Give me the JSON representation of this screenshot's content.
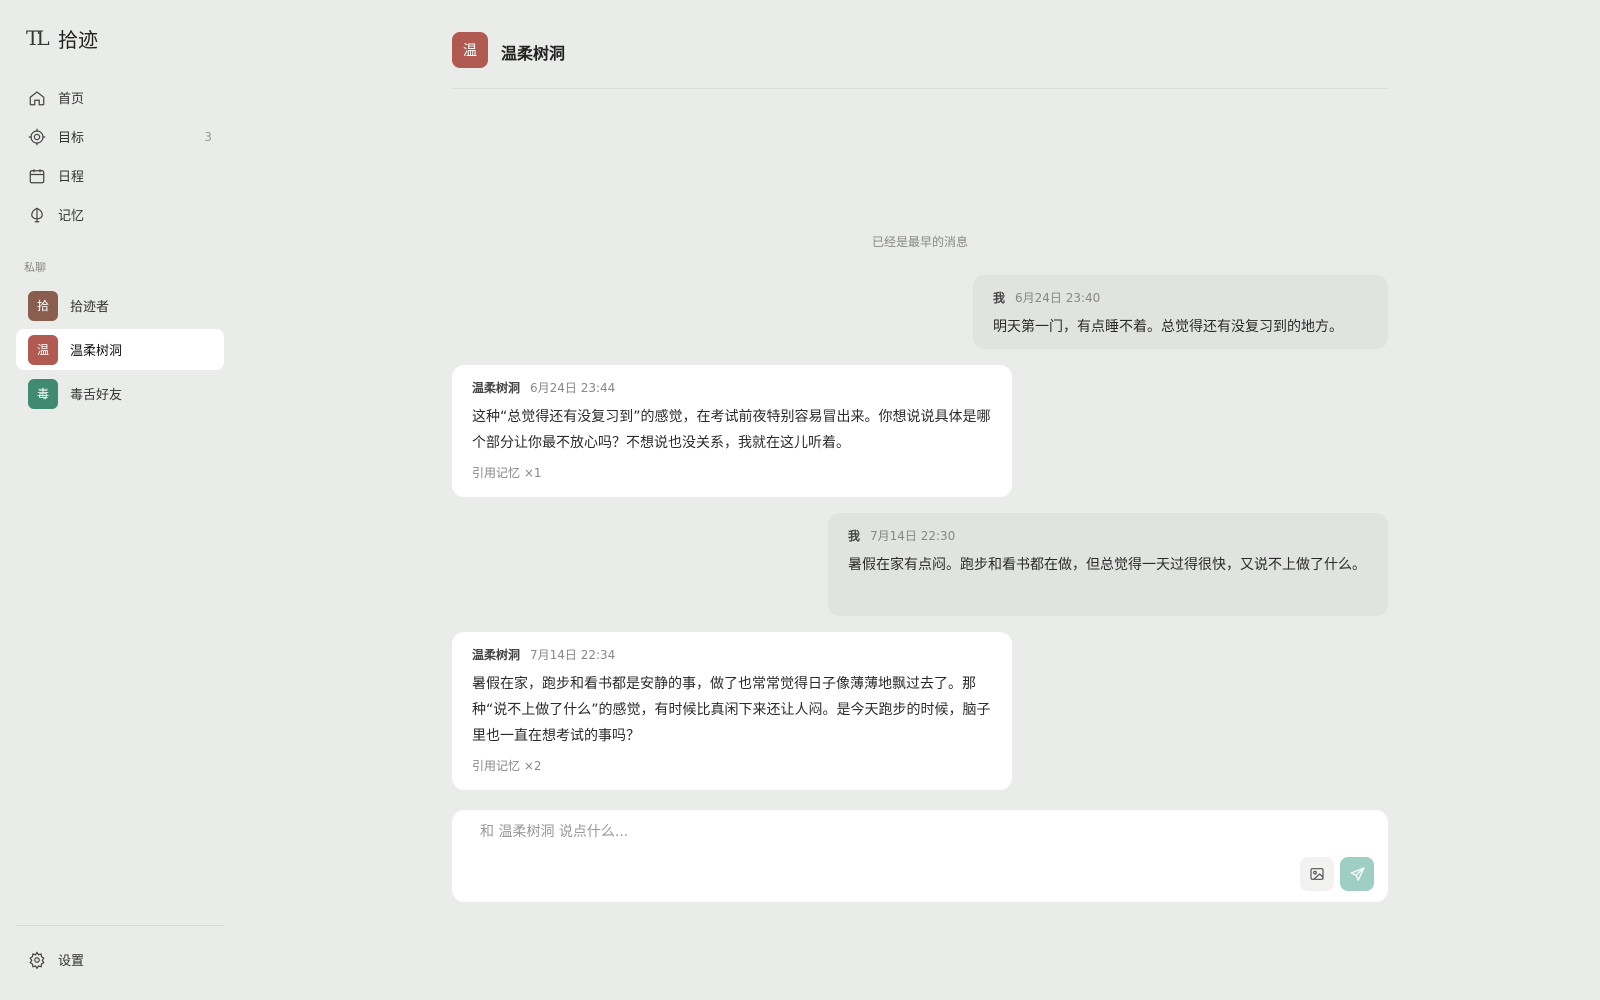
{
  "app": {
    "logo_mark": "TL",
    "name": "拾迹"
  },
  "nav": [
    {
      "label": "首页",
      "icon": "home-icon"
    },
    {
      "label": "目标",
      "icon": "target-icon",
      "count": "3"
    },
    {
      "label": "日程",
      "icon": "calendar-icon"
    },
    {
      "label": "记忆",
      "icon": "memory-icon"
    }
  ],
  "private_chats": {
    "label": "私聊",
    "items": [
      {
        "initial": "拾",
        "name": "拾迹者",
        "color": "#8a5e4e"
      },
      {
        "initial": "温",
        "name": "温柔树洞",
        "color": "#b05a52",
        "active": true
      },
      {
        "initial": "毒",
        "name": "毒舌好友",
        "color": "#3f8a70"
      }
    ]
  },
  "settings": {
    "label": "设置"
  },
  "chat": {
    "avatar": "温",
    "title": "温柔树洞",
    "earliest_notice": "已经是最早的消息",
    "messages": [
      {
        "sender": "我",
        "time": "6月24日 23:40",
        "text": "明天第一门，有点睡不着。总觉得还有没复习到的地方。"
      },
      {
        "sender": "温柔树洞",
        "time": "6月24日 23:44",
        "text": "这种“总觉得还有没复习到”的感觉，在考试前夜特别容易冒出来。你想说说具体是哪个部分让你最不放心吗？不想说也没关系，我就在这儿听着。",
        "cite": "引用记忆",
        "cite_count": "×1"
      },
      {
        "sender": "我",
        "time": "7月14日 22:30",
        "text": "暑假在家有点闷。跑步和看书都在做，但总觉得一天过得很快，又说不上做了什么。"
      },
      {
        "sender": "温柔树洞",
        "time": "7月14日 22:34",
        "text": "暑假在家，跑步和看书都是安静的事，做了也常常觉得日子像薄薄地飘过去了。那种“说不上做了什么”的感觉，有时候比真闲下来还让人闷。是今天跑步的时候，脑子里也一直在想考试的事吗？",
        "cite": "引用记忆",
        "cite_count": "×2"
      }
    ]
  },
  "composer": {
    "placeholder": "和 温柔树洞 说点什么..."
  },
  "colors": {
    "accent": "#9fcfc4",
    "background": "#e9ece8",
    "my_bubble": "#e0e3df"
  }
}
